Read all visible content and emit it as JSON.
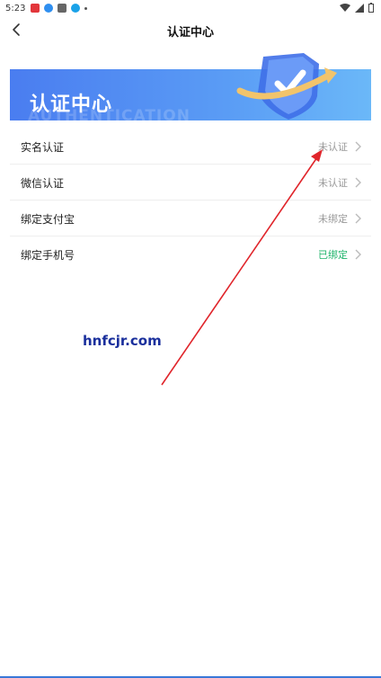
{
  "status_bar": {
    "time": "5:23"
  },
  "nav": {
    "title": "认证中心"
  },
  "banner": {
    "title": "认证中心",
    "subtitle": "AUTHENTICATION"
  },
  "items": [
    {
      "label": "实名认证",
      "value": "未认证",
      "status": "neutral"
    },
    {
      "label": "微信认证",
      "value": "未认证",
      "status": "neutral"
    },
    {
      "label": "绑定支付宝",
      "value": "未绑定",
      "status": "neutral"
    },
    {
      "label": "绑定手机号",
      "value": "已绑定",
      "status": "success"
    }
  ],
  "watermark": "hnfcjr.com",
  "colors": {
    "accent": "#4a7df0",
    "success": "#1fb46b",
    "annotation_arrow": "#e0252b"
  },
  "icons": {
    "back": "chevron-left-icon",
    "row_arrow": "chevron-right-icon",
    "banner": "shield-check-icon"
  }
}
